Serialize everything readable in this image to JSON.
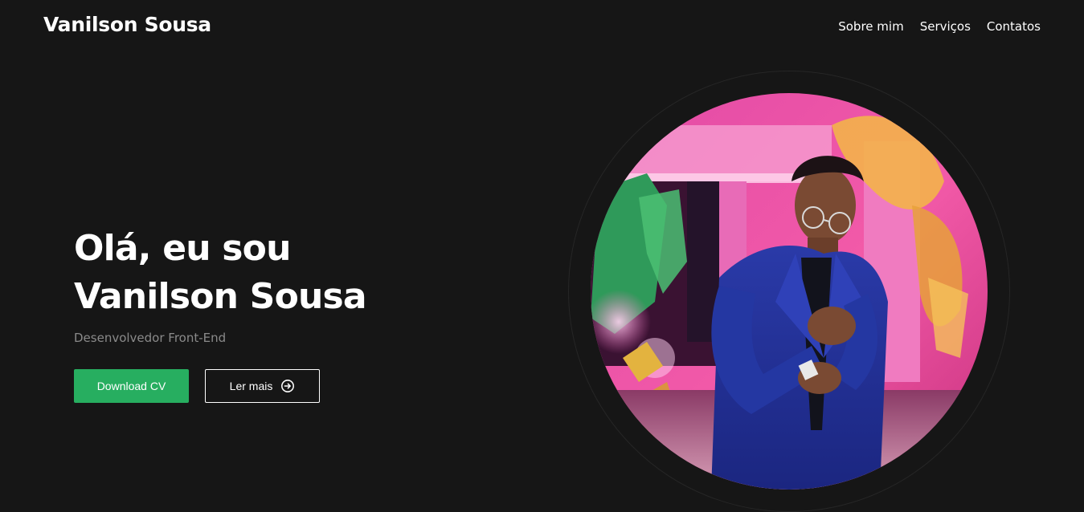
{
  "header": {
    "brand": "Vanilson Sousa",
    "nav": [
      "Sobre mim",
      "Serviços",
      "Contatos"
    ]
  },
  "hero": {
    "greeting": "Olá, eu sou",
    "name": "Vanilson Sousa",
    "role": "Desenvolvedor Front-End",
    "download_label": "Download CV",
    "more_label": "Ler mais"
  },
  "icons": {
    "more": "arrow-right-circle-icon"
  },
  "colors": {
    "background": "#161616",
    "accent": "#27ae60",
    "muted_text": "#8a8a8a"
  }
}
